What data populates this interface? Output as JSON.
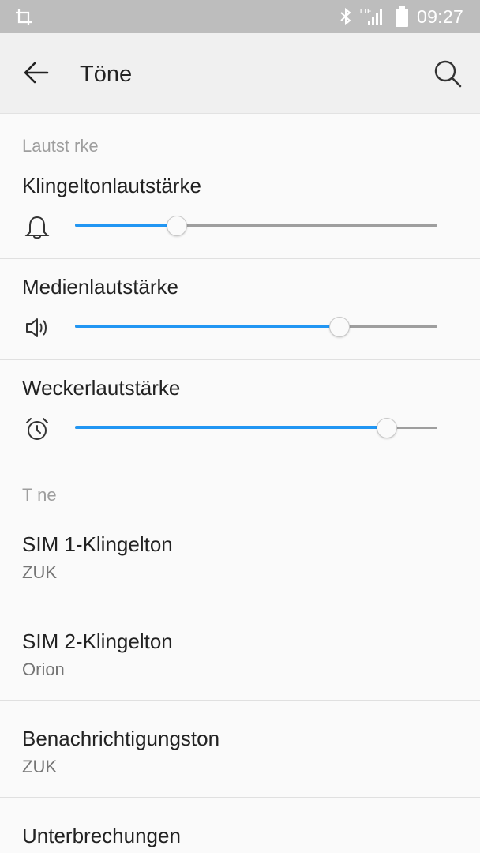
{
  "status_bar": {
    "time": "09:27",
    "icons": [
      "crop-icon",
      "bluetooth-icon",
      "lte-signal-icon",
      "battery-icon"
    ]
  },
  "app_bar": {
    "title": "Töne",
    "back_icon": "arrow-left-icon",
    "search_icon": "search-icon"
  },
  "volume_section": {
    "header": "Lautst   rke",
    "items": [
      {
        "label": "Klingeltonlautstärke",
        "icon": "bell-icon",
        "level_percent": 28
      },
      {
        "label": "Medienlautstärke",
        "icon": "speaker-icon",
        "level_percent": 73
      },
      {
        "label": "Weckerlautstärke",
        "icon": "alarm-clock-icon",
        "level_percent": 86
      }
    ]
  },
  "tones_section": {
    "header": "T    ne",
    "items": [
      {
        "title": "SIM 1-Klingelton",
        "subtitle": "ZUK"
      },
      {
        "title": "SIM 2-Klingelton",
        "subtitle": "Orion"
      },
      {
        "title": "Benachrichtigungston",
        "subtitle": "ZUK"
      },
      {
        "title": "Unterbrechungen",
        "subtitle": ""
      }
    ]
  },
  "colors": {
    "accent": "#2196f3",
    "status_bar": "#bdbdbd",
    "app_bar": "#f0f0f0",
    "background": "#fafafa",
    "secondary_text": "#9e9e9e"
  }
}
